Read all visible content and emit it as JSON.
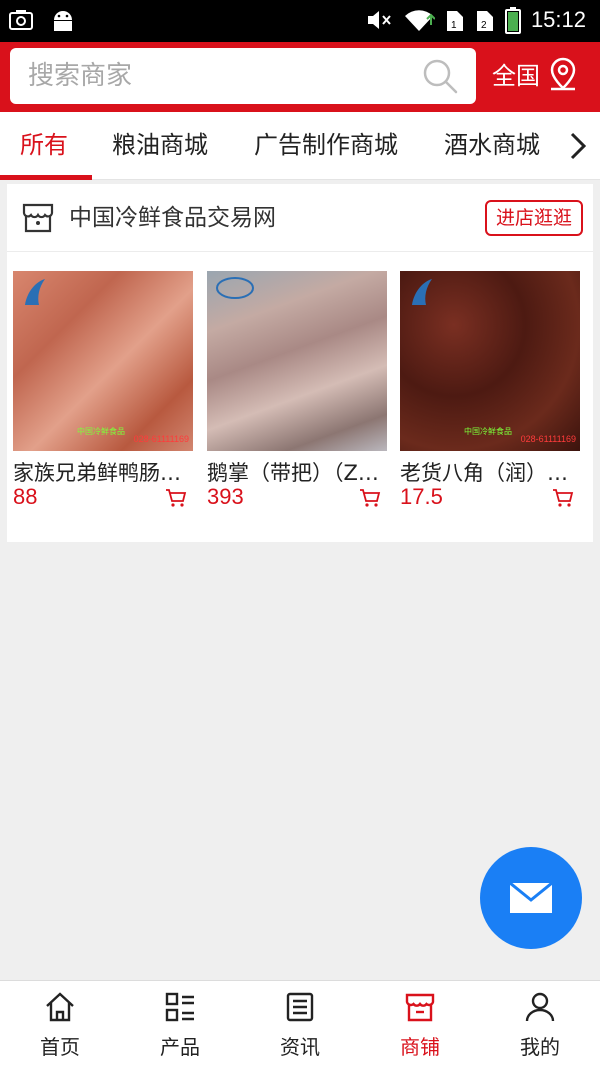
{
  "status_bar": {
    "time": "15:12"
  },
  "search": {
    "placeholder": "搜索商家"
  },
  "region": {
    "label": "全国"
  },
  "tabs": [
    {
      "label": "所有",
      "active": true
    },
    {
      "label": "粮油商城",
      "active": false
    },
    {
      "label": "广告制作商城",
      "active": false
    },
    {
      "label": "酒水商城",
      "active": false
    }
  ],
  "store": {
    "name": "中国冷鲜食品交易网",
    "enter_label": "进店逛逛",
    "products": [
      {
        "name": "家族兄弟鲜鸭肠…",
        "price": "88",
        "image": "duck-intestine-photo",
        "image_text": "028-61111169"
      },
      {
        "name": "鹅掌（带把）（Z…",
        "price": "393",
        "image": "goose-feet-photo"
      },
      {
        "name": "老货八角（润）…",
        "price": "17.5",
        "image": "star-anise-photo",
        "image_text": "028-61111169"
      }
    ]
  },
  "bottom_nav": [
    {
      "label": "首页",
      "icon": "home-icon",
      "active": false
    },
    {
      "label": "产品",
      "icon": "grid-list-icon",
      "active": false
    },
    {
      "label": "资讯",
      "icon": "news-icon",
      "active": false
    },
    {
      "label": "商铺",
      "icon": "shop-icon",
      "active": true
    },
    {
      "label": "我的",
      "icon": "user-icon",
      "active": false
    }
  ],
  "colors": {
    "brand_red": "#d9111b",
    "fab_blue": "#1a7ff5"
  }
}
